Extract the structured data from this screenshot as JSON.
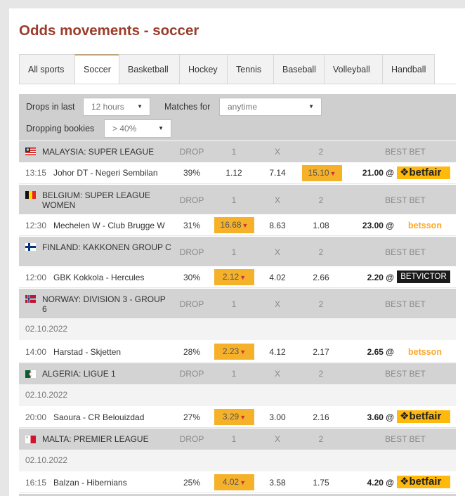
{
  "title": "Odds movements - soccer",
  "tabs": [
    "All sports",
    "Soccer",
    "Basketball",
    "Hockey",
    "Tennis",
    "Baseball",
    "Volleyball",
    "Handball"
  ],
  "active_tab": "Soccer",
  "filters": {
    "drops_label": "Drops in last",
    "drops_value": "12 hours",
    "matches_label": "Matches for",
    "matches_value": "anytime",
    "bookies_label": "Dropping bookies",
    "bookies_value": "> 40%"
  },
  "headers": {
    "drop": "DROP",
    "one": "1",
    "x": "X",
    "two": "2",
    "best": "BEST BET"
  },
  "leagues": [
    {
      "name": "MALAYSIA: SUPER LEAGUE",
      "flag": "malaysia"
    },
    {
      "name": "BELGIUM: SUPER LEAGUE WOMEN",
      "flag": "belgium"
    },
    {
      "name": "FINLAND: KAKKONEN GROUP C",
      "flag": "finland"
    },
    {
      "name": "NORWAY: DIVISION 3 - GROUP 6",
      "flag": "norway"
    },
    {
      "name": "ALGERIA: LIGUE 1",
      "flag": "algeria"
    },
    {
      "name": "MALTA: PREMIER LEAGUE",
      "flag": "malta"
    }
  ],
  "dates": [
    "02.10.2022",
    "02.10.2022",
    "02.10.2022"
  ],
  "matches": [
    {
      "time": "13:15",
      "teams": "Johor DT - Negeri Sembilan",
      "drop": "39%",
      "o1": "1.12",
      "ox": "7.14",
      "o2": "15.10",
      "hi": "2",
      "best": "21.00 @",
      "bookie": "betfair"
    },
    {
      "time": "12:30",
      "teams": "Mechelen W - Club Brugge W",
      "drop": "31%",
      "o1": "16.68",
      "ox": "8.63",
      "o2": "1.08",
      "hi": "1",
      "best": "23.00 @",
      "bookie": "betsson"
    },
    {
      "time": "12:00",
      "teams": "GBK Kokkola - Hercules",
      "drop": "30%",
      "o1": "2.12",
      "ox": "4.02",
      "o2": "2.66",
      "hi": "1",
      "best": "2.20 @",
      "bookie": "BETVICTOR"
    },
    {
      "time": "14:00",
      "teams": "Harstad - Skjetten",
      "drop": "28%",
      "o1": "2.23",
      "ox": "4.12",
      "o2": "2.17",
      "hi": "1",
      "best": "2.65 @",
      "bookie": "betsson"
    },
    {
      "time": "20:00",
      "teams": "Saoura - CR Belouizdad",
      "drop": "27%",
      "o1": "3.29",
      "ox": "3.00",
      "o2": "2.16",
      "hi": "1",
      "best": "3.60 @",
      "bookie": "betfair"
    },
    {
      "time": "16:15",
      "teams": "Balzan - Hibernians",
      "drop": "25%",
      "o1": "4.02",
      "ox": "3.58",
      "o2": "1.75",
      "hi": "1",
      "best": "4.20 @",
      "bookie": "betfair"
    }
  ],
  "colors": {
    "title": "#9b3c2a",
    "highlight": "#f6b12b",
    "header_bg": "#d3d3d3"
  }
}
